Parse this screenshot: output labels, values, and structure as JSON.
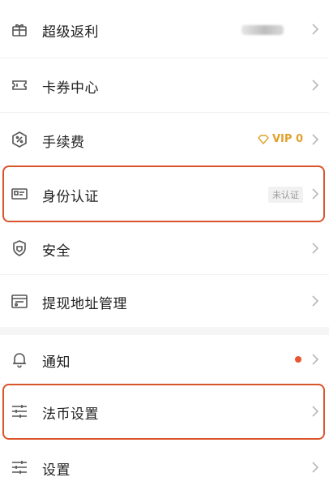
{
  "menu": {
    "items": [
      {
        "id": "super-rebate",
        "label": "超级返利",
        "icon": "gift-icon"
      },
      {
        "id": "card-center",
        "label": "卡券中心",
        "icon": "ticket-icon"
      },
      {
        "id": "fees",
        "label": "手续费",
        "icon": "percent-icon",
        "vip_label": "VIP 0"
      },
      {
        "id": "identity",
        "label": "身份认证",
        "icon": "id-card-icon",
        "status": "未认证"
      },
      {
        "id": "security",
        "label": "安全",
        "icon": "shield-icon"
      },
      {
        "id": "withdraw-address",
        "label": "提现地址管理",
        "icon": "address-book-icon"
      },
      {
        "id": "notifications",
        "label": "通知",
        "icon": "bell-icon"
      },
      {
        "id": "fiat-settings",
        "label": "法币设置",
        "icon": "sliders-icon"
      },
      {
        "id": "settings",
        "label": "设置",
        "icon": "sliders-icon"
      }
    ]
  },
  "colors": {
    "highlight": "#d9542a",
    "vip": "#e0a12b",
    "notification_dot": "#e8552f",
    "chevron": "#b8b8b8",
    "icon": "#555555"
  }
}
